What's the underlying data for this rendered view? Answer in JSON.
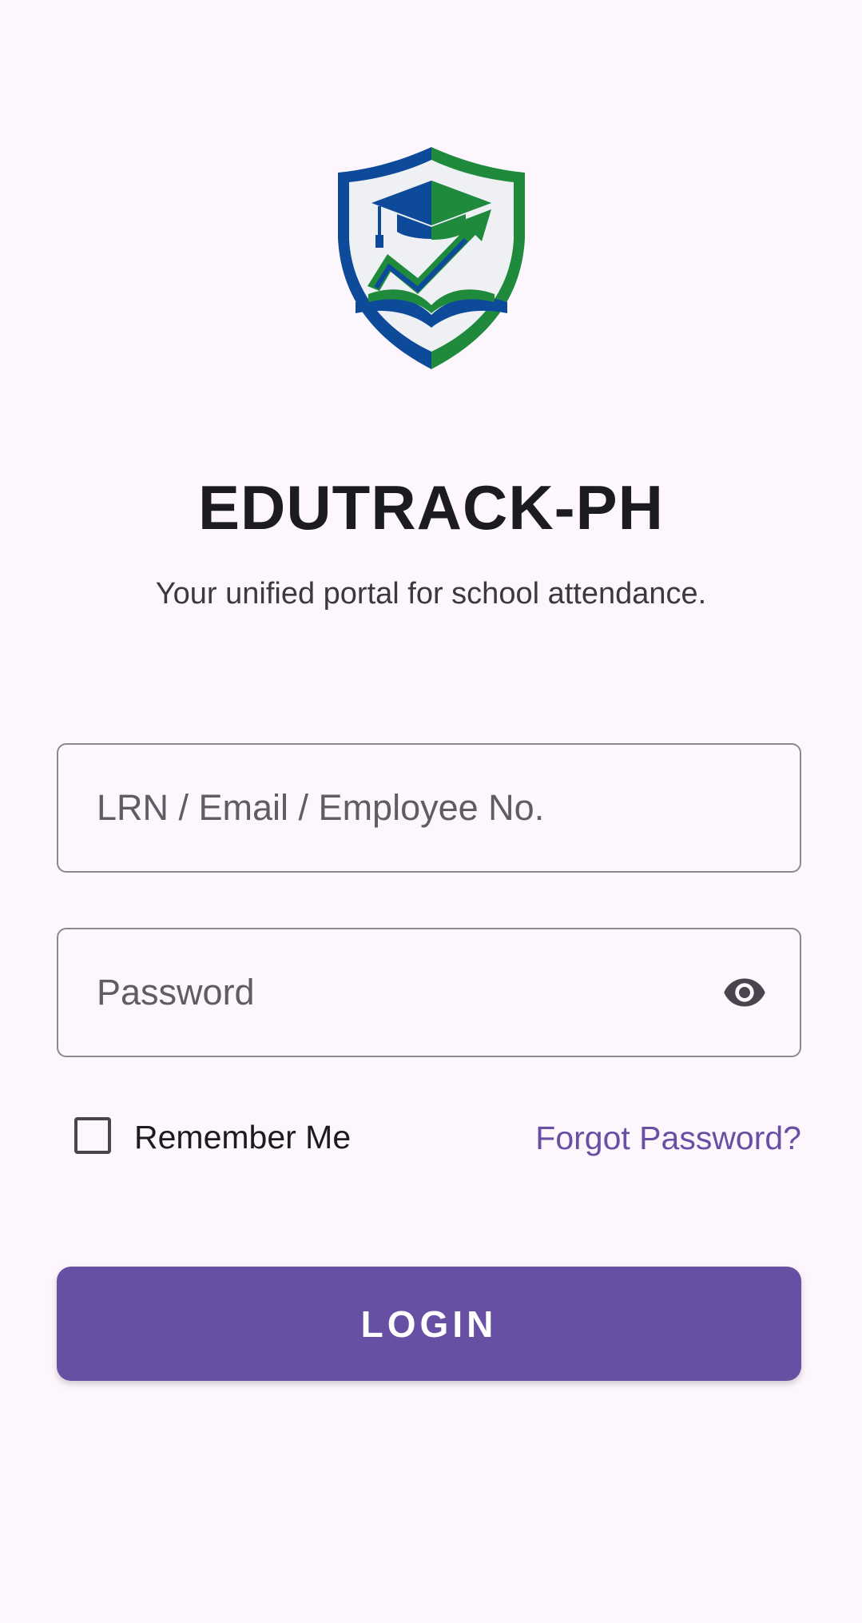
{
  "app": {
    "title": "EDUTRACK-PH",
    "subtitle": "Your unified portal for school attendance."
  },
  "form": {
    "identifier_placeholder": "LRN / Email / Employee No.",
    "identifier_value": "",
    "password_placeholder": "Password",
    "password_value": "",
    "password_toggle_icon": "eye-icon",
    "remember_label": "Remember Me",
    "remember_checked": false,
    "forgot_label": "Forgot Password?",
    "login_label": "LOGIN"
  },
  "colors": {
    "primary": "#6750a4",
    "background": "#fdf7fd",
    "logo_blue": "#0d4a9a",
    "logo_green": "#1f8a3c"
  }
}
